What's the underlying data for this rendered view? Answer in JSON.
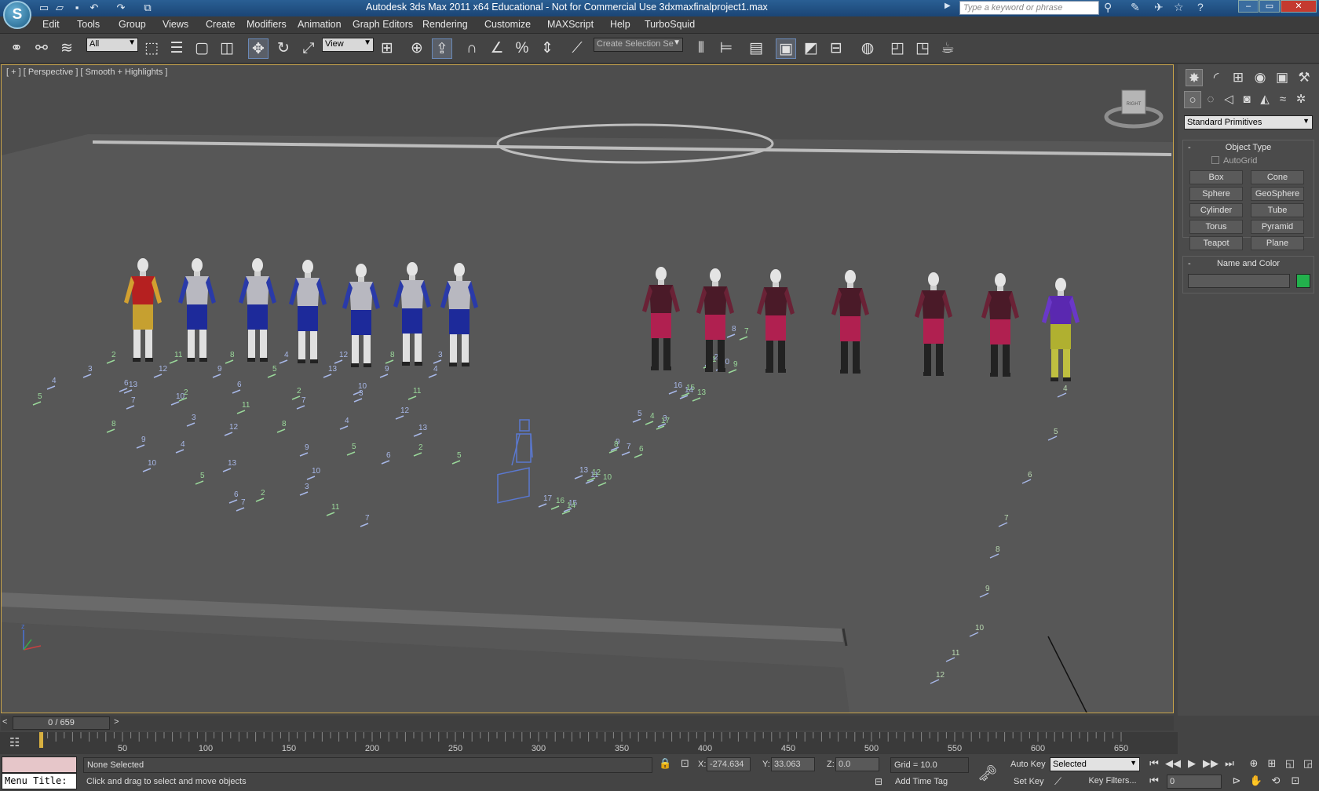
{
  "app": {
    "logo": "S",
    "title": "Autodesk 3ds Max  2011 x64    Educational - Not for Commercial Use    3dxmaxfinalproject1.max",
    "search_placeholder": "Type a keyword or phrase",
    "window_controls": [
      "–",
      "▭",
      "✕"
    ]
  },
  "menu": [
    "Edit",
    "Tools",
    "Group",
    "Views",
    "Create",
    "Modifiers",
    "Animation",
    "Graph Editors",
    "Rendering",
    "Customize",
    "MAXScript",
    "Help",
    "TurboSquid"
  ],
  "toolbar": {
    "filter_value": "All",
    "refcoord_value": "View",
    "selection_set_placeholder": "Create Selection Se",
    "icons": [
      "link-icon",
      "unlink-icon",
      "bind-spacewarp-icon",
      "select-object-icon",
      "select-by-name-icon",
      "rect-region-icon",
      "window-crossing-icon",
      "select-move-icon",
      "select-rotate-icon",
      "select-scale-icon",
      "pivot-center-icon",
      "manipulate-icon",
      "keyboard-shortcut-icon",
      "snap-toggle-icon",
      "angle-snap-icon",
      "percent-snap-icon",
      "spinner-snap-icon",
      "edit-named-sets-icon",
      "mirror-icon",
      "align-icon",
      "layer-manager-icon",
      "graphite-icon",
      "curve-editor-icon",
      "schematic-view-icon",
      "material-editor-icon",
      "render-setup-icon",
      "rendered-frame-icon",
      "render-production-icon"
    ]
  },
  "viewport": {
    "label": "[ + ] [ Perspective ] [ Smooth + Highlights ]",
    "viewcube_label": "RIGHT"
  },
  "command_panel": {
    "tabs": [
      "create-tab-icon",
      "modify-tab-icon",
      "hierarchy-tab-icon",
      "motion-tab-icon",
      "display-tab-icon",
      "utilities-tab-icon"
    ],
    "subtabs": [
      "geometry-icon",
      "shapes-icon",
      "lights-icon",
      "cameras-icon",
      "helpers-icon",
      "spacewarps-icon",
      "systems-icon"
    ],
    "category": "Standard Primitives",
    "object_type": {
      "title": "Object Type",
      "autogrid": "AutoGrid",
      "buttons": [
        "Box",
        "Cone",
        "Sphere",
        "GeoSphere",
        "Cylinder",
        "Tube",
        "Torus",
        "Pyramid",
        "Teapot",
        "Plane"
      ]
    },
    "name_and_color": {
      "title": "Name and Color",
      "name_value": "",
      "color": "#22b14c"
    }
  },
  "timeline": {
    "slider_text": "0 / 659",
    "ticks": [
      "50",
      "100",
      "150",
      "200",
      "250",
      "300",
      "350",
      "400",
      "450",
      "500",
      "550",
      "600",
      "650"
    ]
  },
  "status": {
    "macro_label": "Menu Title:",
    "selection": "None Selected",
    "prompt": "Click and drag to select and move objects",
    "x_label": "X:",
    "x_value": "-274.634",
    "y_label": "Y:",
    "y_value": "33.063",
    "z_label": "Z:",
    "z_value": "0.0",
    "grid": "Grid = 10.0",
    "add_time_tag": "Add Time Tag",
    "auto_key": "Auto Key",
    "set_key": "Set Key",
    "key_mode": "Selected",
    "key_filters": "Key Filters...",
    "current_frame": "0"
  }
}
